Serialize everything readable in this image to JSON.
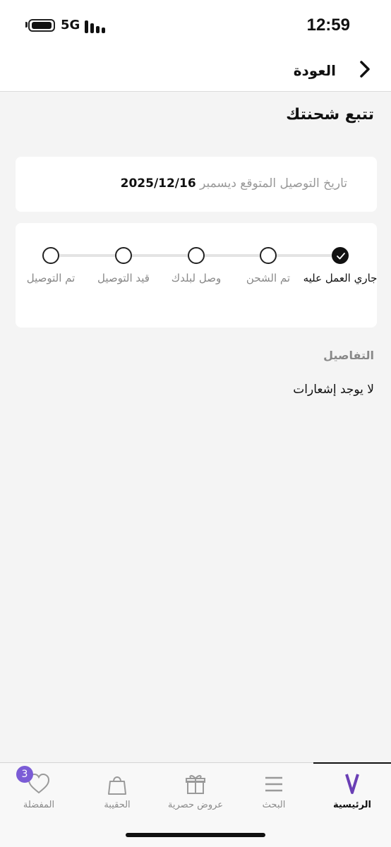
{
  "status_bar": {
    "network": "5G",
    "time": "12:59"
  },
  "nav": {
    "back_label": "العودة"
  },
  "page": {
    "title": "تتبع شحنتك"
  },
  "delivery": {
    "label": "تاريخ التوصيل المتوقع ديسمبر",
    "date": "2025/12/16"
  },
  "tracking": {
    "steps": [
      {
        "label": "جاري العمل عليه",
        "done": true
      },
      {
        "label": "تم الشحن",
        "done": false
      },
      {
        "label": "وصل لبلدك",
        "done": false
      },
      {
        "label": "قيد التوصيل",
        "done": false
      },
      {
        "label": "تم التوصيل",
        "done": false
      }
    ]
  },
  "details": {
    "title": "التفاصيل",
    "empty_message": "لا يوجد إشعارات"
  },
  "tab_bar": {
    "items": [
      {
        "label": "الرئيسية",
        "icon": "brand-logo-icon",
        "active": true
      },
      {
        "label": "البحث",
        "icon": "menu-icon",
        "active": false
      },
      {
        "label": "عروض حصرية",
        "icon": "gift-icon",
        "active": false
      },
      {
        "label": "الحقيبة",
        "icon": "bag-icon",
        "active": false
      },
      {
        "label": "المفضلة",
        "icon": "heart-icon",
        "active": false,
        "badge": "3"
      }
    ]
  },
  "colors": {
    "accent": "#7b5cd6",
    "background": "#f4f4f4"
  }
}
